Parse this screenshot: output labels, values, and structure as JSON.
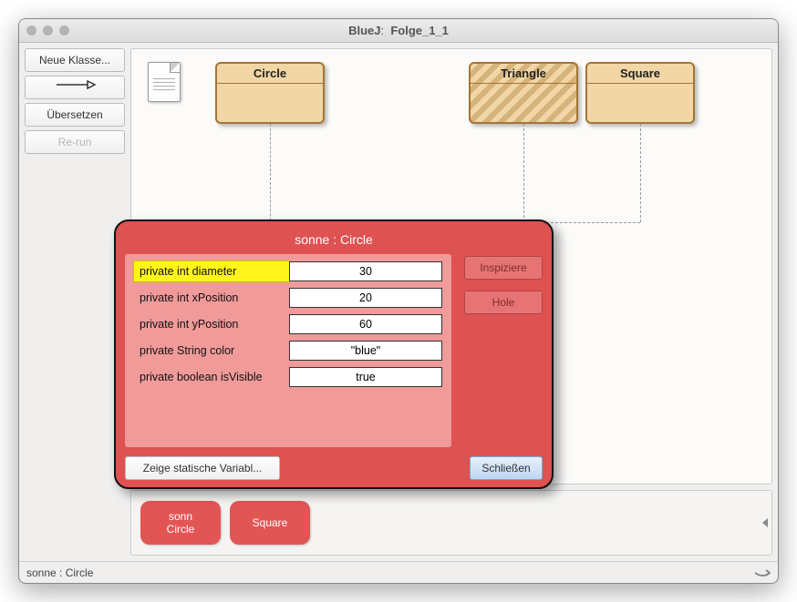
{
  "window": {
    "app": "BlueJ",
    "project": "Folge_1_1"
  },
  "sidebar": {
    "new_class": "Neue Klasse...",
    "arrow_tool": "→",
    "compile": "Übersetzen",
    "rerun": "Re-run"
  },
  "classes": {
    "circle": "Circle",
    "triangle": "Triangle",
    "square": "Square"
  },
  "bench": {
    "objects": [
      {
        "name": "sonn",
        "type": "Circle"
      },
      {
        "name": " ",
        "type": "Square"
      }
    ]
  },
  "status": {
    "text": "sonne : Circle"
  },
  "inspector": {
    "title": "sonne : Circle",
    "fields": [
      {
        "label": "private int diameter",
        "value": "30",
        "selected": true
      },
      {
        "label": "private int xPosition",
        "value": "20",
        "selected": false
      },
      {
        "label": "private int yPosition",
        "value": "60",
        "selected": false
      },
      {
        "label": "private String color",
        "value": "\"blue\"",
        "selected": false
      },
      {
        "label": "private boolean isVisible",
        "value": "true",
        "selected": false
      }
    ],
    "buttons": {
      "inspect": "Inspiziere",
      "get": "Hole",
      "static": "Zeige statische Variabl...",
      "close": "Schließen"
    }
  }
}
